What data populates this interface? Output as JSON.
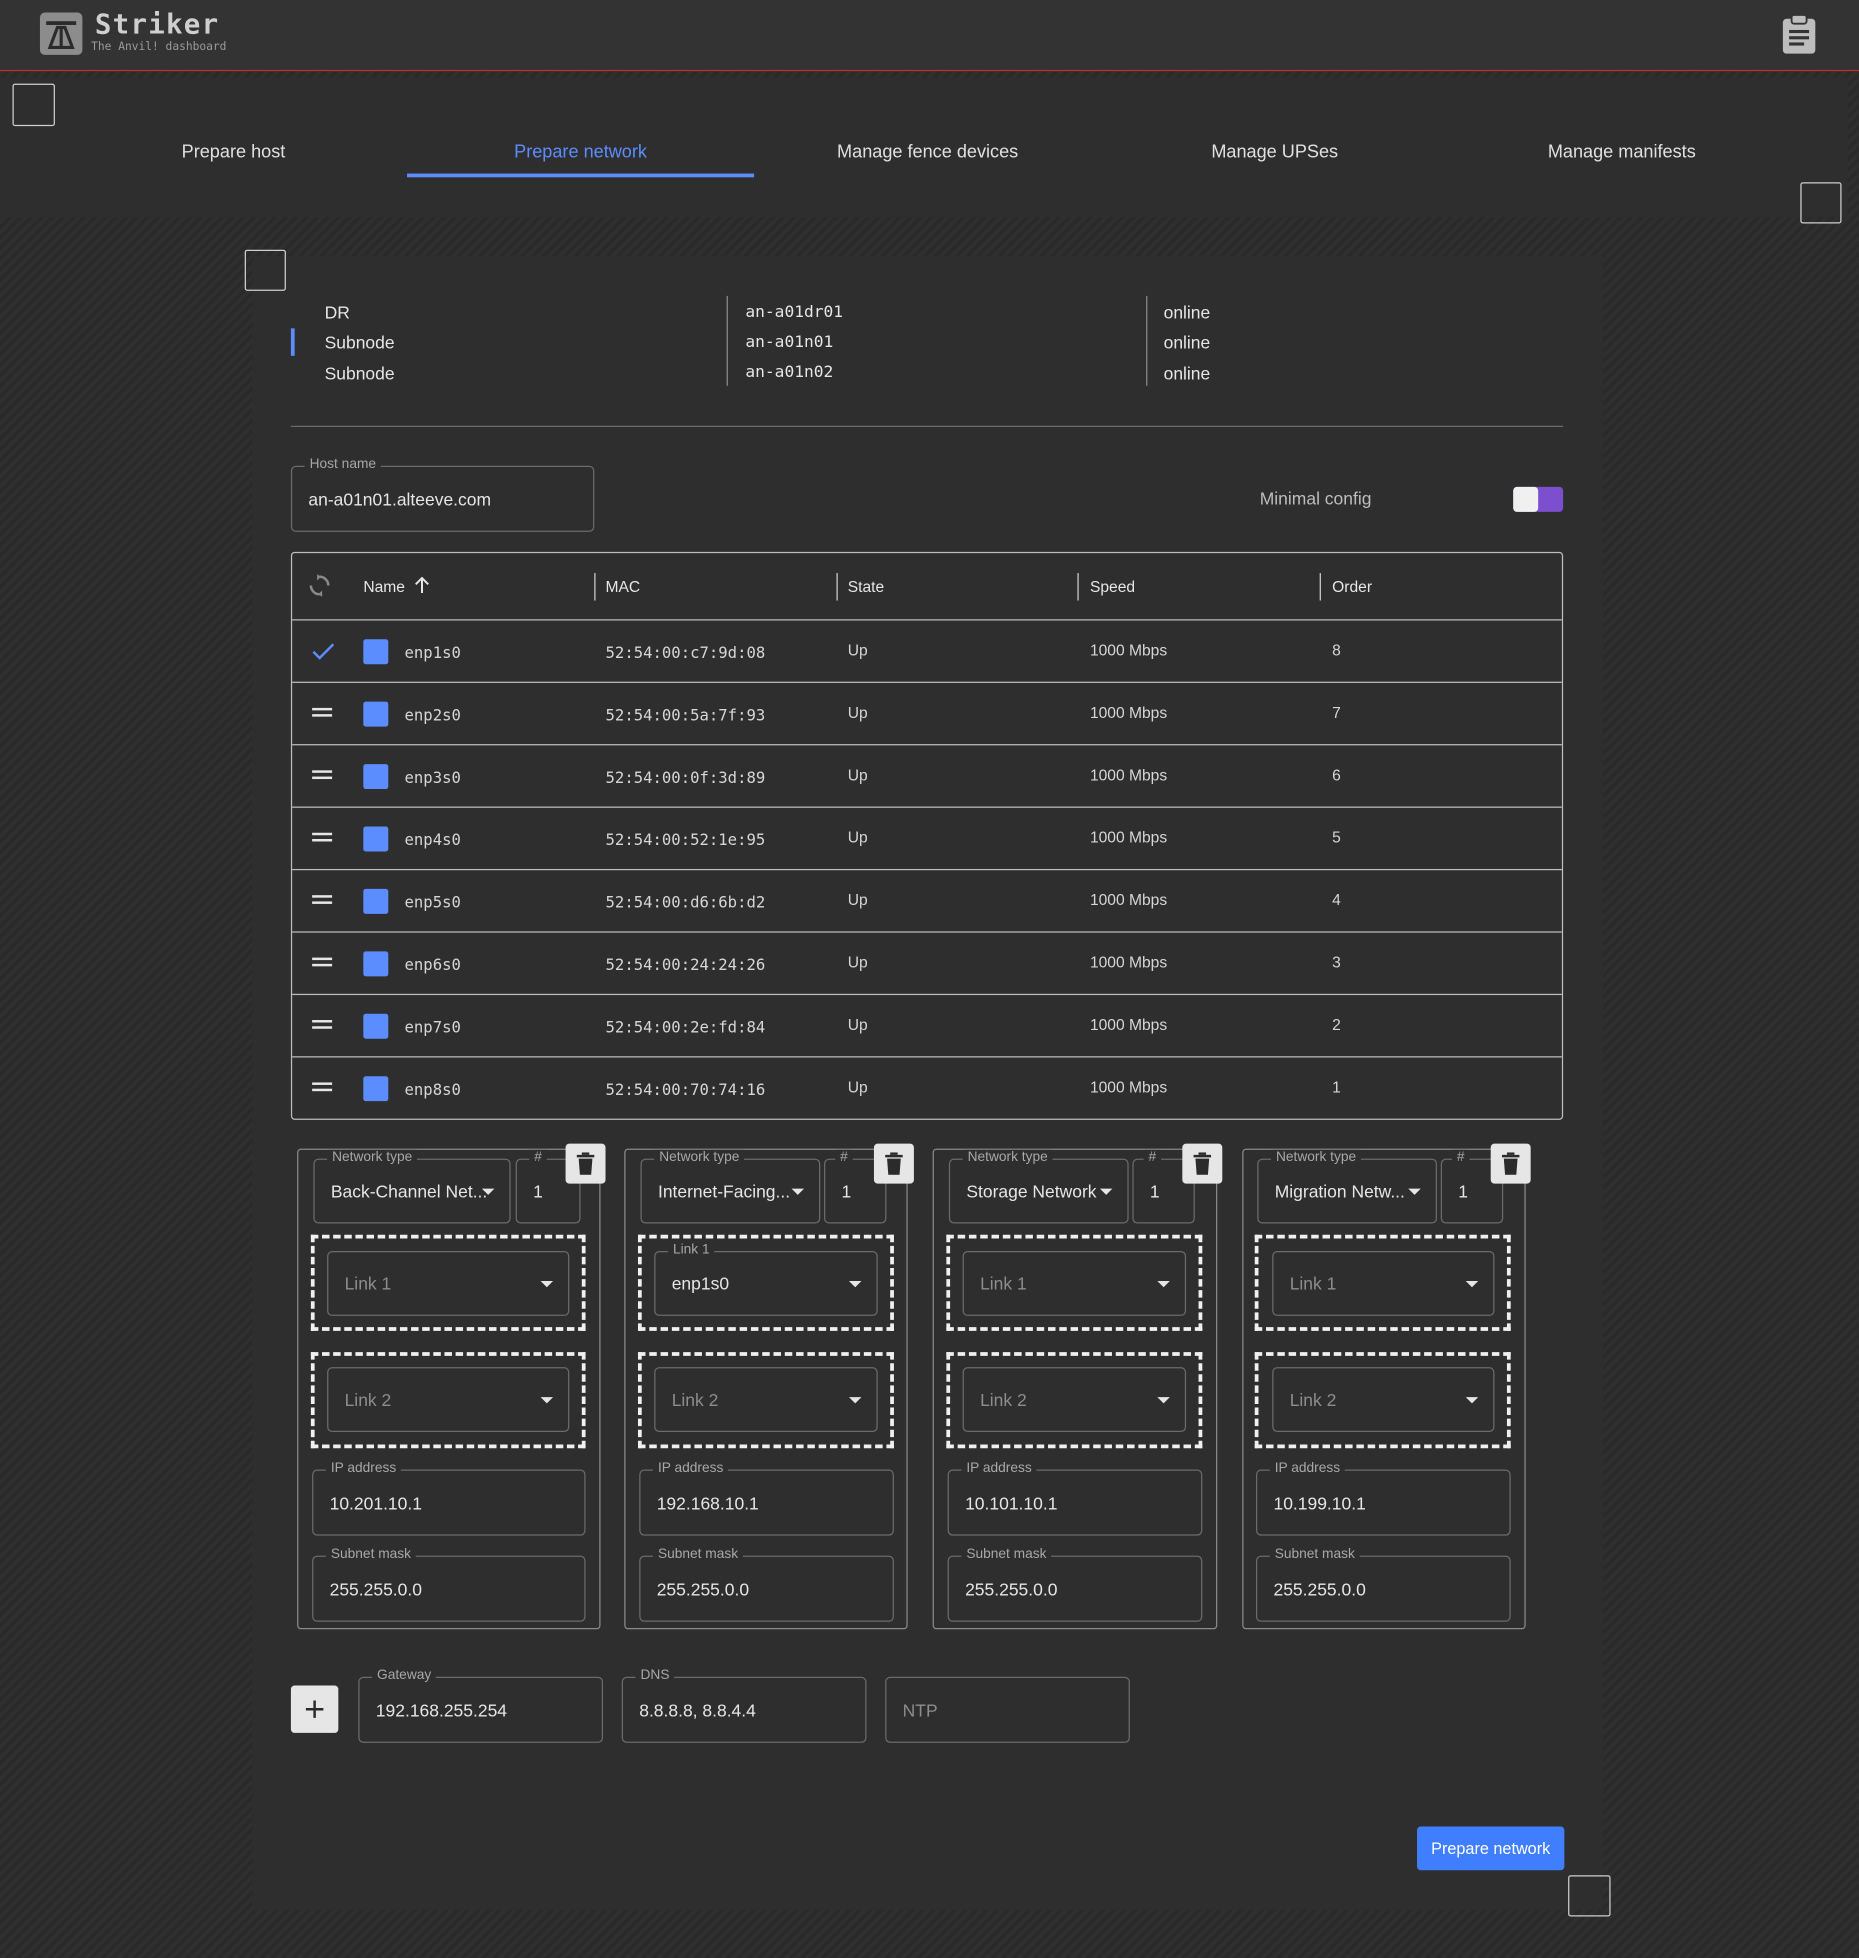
{
  "app": {
    "title": "Striker",
    "subtitle": "The Anvil! dashboard"
  },
  "tabs": [
    {
      "label": "Prepare host",
      "active": false
    },
    {
      "label": "Prepare network",
      "active": true
    },
    {
      "label": "Manage fence devices",
      "active": false
    },
    {
      "label": "Manage UPSes",
      "active": false
    },
    {
      "label": "Manage manifests",
      "active": false
    }
  ],
  "hosts": [
    {
      "type": "DR",
      "name": "an-a01dr01",
      "status": "online",
      "selected": false
    },
    {
      "type": "Subnode",
      "name": "an-a01n01",
      "status": "online",
      "selected": true
    },
    {
      "type": "Subnode",
      "name": "an-a01n02",
      "status": "online",
      "selected": false
    }
  ],
  "host_name": {
    "label": "Host name",
    "value": "an-a01n01.alteeve.com"
  },
  "minimal_config": {
    "label": "Minimal config",
    "on": true
  },
  "interfaces": {
    "columns": [
      "Name",
      "MAC",
      "State",
      "Speed",
      "Order"
    ],
    "rows": [
      {
        "name": "enp1s0",
        "mac": "52:54:00:c7:9d:08",
        "state": "Up",
        "speed": "1000 Mbps",
        "order": "8",
        "applied": true
      },
      {
        "name": "enp2s0",
        "mac": "52:54:00:5a:7f:93",
        "state": "Up",
        "speed": "1000 Mbps",
        "order": "7",
        "applied": false
      },
      {
        "name": "enp3s0",
        "mac": "52:54:00:0f:3d:89",
        "state": "Up",
        "speed": "1000 Mbps",
        "order": "6",
        "applied": false
      },
      {
        "name": "enp4s0",
        "mac": "52:54:00:52:1e:95",
        "state": "Up",
        "speed": "1000 Mbps",
        "order": "5",
        "applied": false
      },
      {
        "name": "enp5s0",
        "mac": "52:54:00:d6:6b:d2",
        "state": "Up",
        "speed": "1000 Mbps",
        "order": "4",
        "applied": false
      },
      {
        "name": "enp6s0",
        "mac": "52:54:00:24:24:26",
        "state": "Up",
        "speed": "1000 Mbps",
        "order": "3",
        "applied": false
      },
      {
        "name": "enp7s0",
        "mac": "52:54:00:2e:fd:84",
        "state": "Up",
        "speed": "1000 Mbps",
        "order": "2",
        "applied": false
      },
      {
        "name": "enp8s0",
        "mac": "52:54:00:70:74:16",
        "state": "Up",
        "speed": "1000 Mbps",
        "order": "1",
        "applied": false
      }
    ]
  },
  "networks": [
    {
      "type_label": "Network type",
      "type": "Back-Channel Net...",
      "num_label": "#",
      "num": "1",
      "link1": {
        "label": "Link 1",
        "value": ""
      },
      "link2": {
        "label": "Link 2",
        "value": ""
      },
      "ip_label": "IP address",
      "ip": "10.201.10.1",
      "mask_label": "Subnet mask",
      "mask": "255.255.0.0"
    },
    {
      "type_label": "Network type",
      "type": "Internet-Facing...",
      "num_label": "#",
      "num": "1",
      "link1": {
        "label": "Link 1",
        "value": "enp1s0"
      },
      "link2": {
        "label": "Link 2",
        "value": ""
      },
      "ip_label": "IP address",
      "ip": "192.168.10.1",
      "mask_label": "Subnet mask",
      "mask": "255.255.0.0"
    },
    {
      "type_label": "Network type",
      "type": "Storage Network",
      "num_label": "#",
      "num": "1",
      "link1": {
        "label": "Link 1",
        "value": ""
      },
      "link2": {
        "label": "Link 2",
        "value": ""
      },
      "ip_label": "IP address",
      "ip": "10.101.10.1",
      "mask_label": "Subnet mask",
      "mask": "255.255.0.0"
    },
    {
      "type_label": "Network type",
      "type": "Migration Netw...",
      "num_label": "#",
      "num": "1",
      "link1": {
        "label": "Link 1",
        "value": ""
      },
      "link2": {
        "label": "Link 2",
        "value": ""
      },
      "ip_label": "IP address",
      "ip": "10.199.10.1",
      "mask_label": "Subnet mask",
      "mask": "255.255.0.0"
    }
  ],
  "gateway": {
    "label": "Gateway",
    "value": "192.168.255.254"
  },
  "dns": {
    "label": "DNS",
    "value": "8.8.8.8, 8.8.4.4"
  },
  "ntp": {
    "placeholder": "NTP",
    "value": ""
  },
  "submit_label": "Prepare network",
  "colors": {
    "accent": "#5b8dff",
    "toggle": "#7c4fcf",
    "header_border": "#c0312f",
    "button": "#3f7fff"
  }
}
